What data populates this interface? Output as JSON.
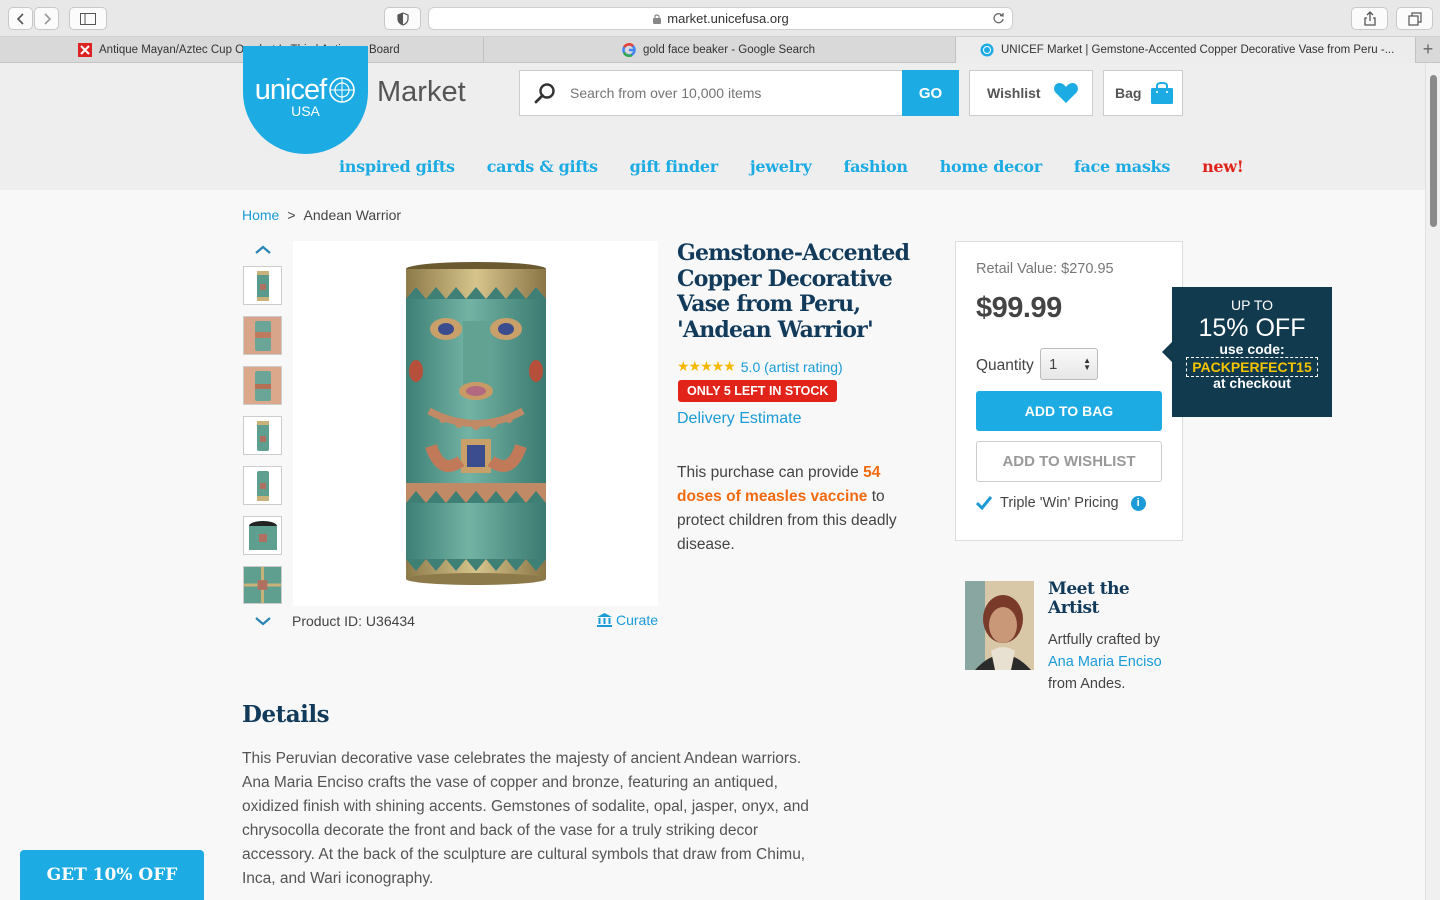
{
  "browser": {
    "url": "market.unicefusa.org",
    "tabs": [
      {
        "title": "Antique Mayan/Aztec Cup Or what Is This | Antiques Board"
      },
      {
        "title": "gold face beaker - Google Search"
      },
      {
        "title": "UNICEF Market | Gemstone-Accented Copper Decorative Vase from Peru -..."
      }
    ],
    "new_tab": "+"
  },
  "header": {
    "logo_main": "unicef",
    "logo_sub": "USA",
    "market_label": "Market",
    "search_placeholder": "Search from over 10,000 items",
    "go_label": "GO",
    "wishlist_label": "Wishlist",
    "bag_label": "Bag"
  },
  "nav": [
    {
      "label": "inspired gifts"
    },
    {
      "label": "cards & gifts"
    },
    {
      "label": "gift finder"
    },
    {
      "label": "jewelry"
    },
    {
      "label": "fashion"
    },
    {
      "label": "home decor"
    },
    {
      "label": "face masks"
    },
    {
      "label": "new!"
    }
  ],
  "breadcrumb": {
    "home": "Home",
    "separator": ">",
    "current": "Andean Warrior"
  },
  "product": {
    "title": "Gemstone-Accented Copper Decorative Vase from Peru, 'Andean Warrior'",
    "stars": "★★★★★",
    "rating_text": "5.0 (artist rating)",
    "stock_badge": "ONLY 5 LEFT IN STOCK",
    "delivery_link": "Delivery Estimate",
    "purchase_pre": "This purchase can provide ",
    "purchase_highlight": "54 doses of measles vaccine",
    "purchase_post": " to protect children from this deadly disease.",
    "product_id": "Product ID: U36434",
    "curate_label": "Curate"
  },
  "pricing": {
    "retail_value": "Retail Value: $270.95",
    "price": "$99.99",
    "quantity_label": "Quantity",
    "quantity_value": "1",
    "add_to_bag": "ADD TO BAG",
    "add_to_wishlist": "ADD TO WISHLIST",
    "triple_win": "Triple 'Win' Pricing",
    "info_icon": "i"
  },
  "promo": {
    "line1": "UP TO",
    "line2": "15% OFF",
    "line3": "use code:",
    "code": "PACKPERFECT15",
    "line4": "at checkout"
  },
  "artist": {
    "heading": "Meet the Artist",
    "crafted_by": "Artfully crafted by",
    "name": "Ana Maria Enciso",
    "from": "from Andes."
  },
  "details": {
    "heading": "Details",
    "text": "This Peruvian decorative vase celebrates the majesty of ancient Andean warriors. Ana Maria Enciso crafts the vase of copper and bronze, featuring an antiqued, oxidized finish with shining accents. Gemstones of sodalite, opal, jasper, onyx, and chrysocolla decorate the front and back of the vase for a truly striking decor accessory. At the back of the sculpture are cultural symbols that draw from Chimu, Inca, and Wari iconography."
  },
  "floating": {
    "get_off": "GET 10% OFF"
  },
  "colors": {
    "brand_blue": "#1cabe2",
    "navy": "#123a5a",
    "alert_red": "#e2231a",
    "highlight_orange": "#f26a10",
    "promo_code": "#f5c400"
  }
}
